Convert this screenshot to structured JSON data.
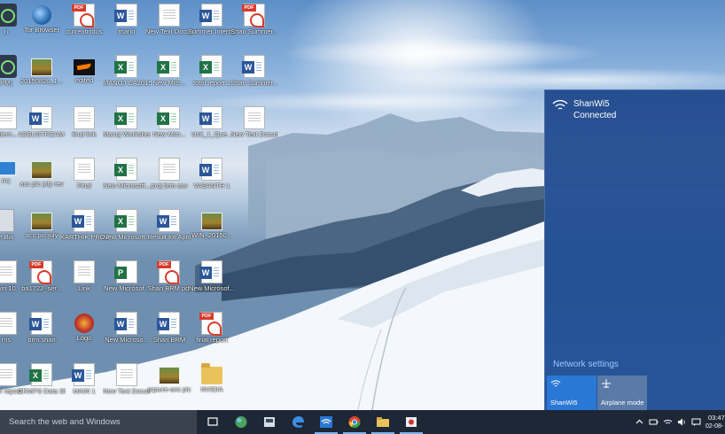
{
  "desktop": {
    "icons": [
      {
        "label": "n",
        "type": "app"
      },
      {
        "label": "Tor Browser",
        "type": "globe"
      },
      {
        "label": "currentindus",
        "type": "pdf"
      },
      {
        "label": "mano",
        "type": "word"
      },
      {
        "label": "New Text Document",
        "type": "doc"
      },
      {
        "label": "Summer Internshi...",
        "type": "word"
      },
      {
        "label": "Shan Summer...",
        "type": "pdf"
      },
      {
        "label": "PM)",
        "type": "app"
      },
      {
        "label": "20150826_1...",
        "type": "photo"
      },
      {
        "label": "edited",
        "type": "nike"
      },
      {
        "label": "MANOJ CA2015",
        "type": "excel"
      },
      {
        "label": "New Micr...",
        "type": "excel"
      },
      {
        "label": "total report 1",
        "type": "excel"
      },
      {
        "label": "Shan Summer...",
        "type": "word"
      },
      {
        "label": "Intern...",
        "type": "doc"
      },
      {
        "label": "ADBUSTREAM PROJECT",
        "type": "word"
      },
      {
        "label": "final link",
        "type": "doc"
      },
      {
        "label": "Manoj Worksheet",
        "type": "excel"
      },
      {
        "label": "New Micr...",
        "type": "excel"
      },
      {
        "label": "Unit_1_Que...",
        "type": "word"
      },
      {
        "label": "New Text Docum...",
        "type": "doc"
      },
      {
        "label": "PC",
        "type": "pc"
      },
      {
        "label": "acc pic july rev",
        "type": "photo"
      },
      {
        "label": "Final",
        "type": "doc"
      },
      {
        "label": "New Microsoft...",
        "type": "excel"
      },
      {
        "label": "proj brm sav",
        "type": "doc"
      },
      {
        "label": "VASANTH 1",
        "type": "word"
      },
      {
        "label": "e Bin",
        "type": "bin"
      },
      {
        "label": "acc pic july",
        "type": "photo"
      },
      {
        "label": "KARTHIK PROJECT",
        "type": "word"
      },
      {
        "label": "New Microsoft...",
        "type": "excel"
      },
      {
        "label": "Result for April",
        "type": "word"
      },
      {
        "label": "WIN_20150...",
        "type": "photo"
      },
      {
        "label": "win 10",
        "type": "doc"
      },
      {
        "label": "ba1722_ser...",
        "type": "pdf"
      },
      {
        "label": "Link",
        "type": "doc"
      },
      {
        "label": "New Microsof...",
        "type": "ppt"
      },
      {
        "label": "Shan BRM pdf",
        "type": "pdf"
      },
      {
        "label": "New Microsof...",
        "type": "word"
      },
      {
        "label": "rns",
        "type": "doc"
      },
      {
        "label": "brm shan",
        "type": "word"
      },
      {
        "label": "Logo",
        "type": "logo"
      },
      {
        "label": "New Microso...",
        "type": "word"
      },
      {
        "label": "Shan BRM",
        "type": "word"
      },
      {
        "label": "final report",
        "type": "pdf"
      },
      {
        "label": "mer report",
        "type": "doc"
      },
      {
        "label": "CRMPS Data Sheet",
        "type": "excel"
      },
      {
        "label": "MAIN 1",
        "type": "word"
      },
      {
        "label": "New Text Docum...",
        "type": "doc"
      },
      {
        "label": "sqaure-acc pic",
        "type": "photo"
      },
      {
        "label": "NVIDIA",
        "type": "folder"
      }
    ]
  },
  "flyout": {
    "network_name": "ShanWi5",
    "network_status": "Connected",
    "settings_link": "Network settings",
    "tiles": {
      "wifi_label": "ShanWi5",
      "airplane_label": "Airplane mode"
    },
    "colors": {
      "background": "#1e488c",
      "tile_active": "#2a78d6",
      "tile_inactive": "#5a7ba8"
    }
  },
  "taskbar": {
    "search_placeholder": "Search the web and Windows",
    "apps": [
      "task-view-icon",
      "browser-globe-icon",
      "store-icon",
      "edge-icon",
      "wifi-app-icon",
      "chrome-icon",
      "file-explorer-icon",
      "media-icon"
    ],
    "clock_time": "03:47",
    "clock_date": "02-08-"
  }
}
